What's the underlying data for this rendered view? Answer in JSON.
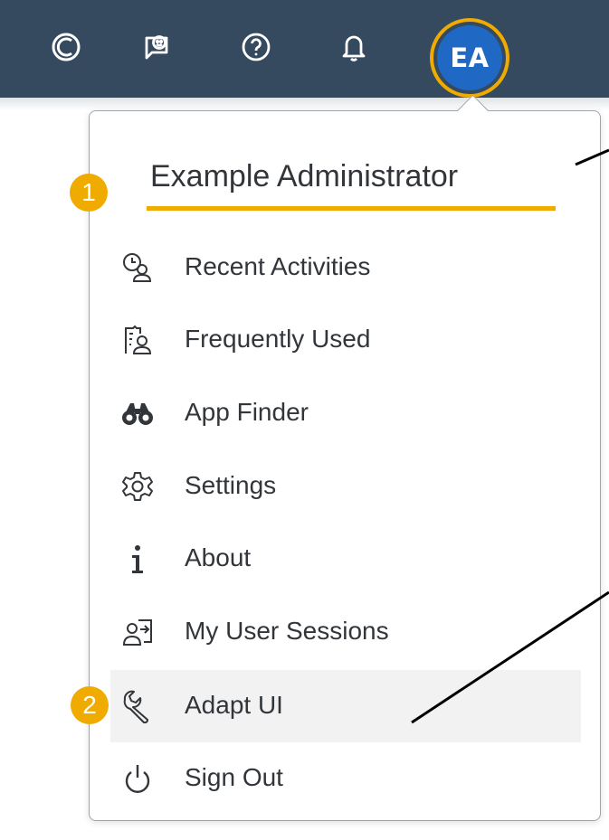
{
  "shellbar": {
    "avatar_initials": "EA",
    "icons": [
      "copilot-icon",
      "feedback-icon",
      "help-icon",
      "notification-bell-icon"
    ]
  },
  "user_menu": {
    "user_name": "Example Administrator",
    "items": [
      {
        "label": "Recent Activities",
        "icon": "recent-activities-icon"
      },
      {
        "label": "Frequently Used",
        "icon": "frequently-used-icon"
      },
      {
        "label": "App Finder",
        "icon": "binoculars-icon"
      },
      {
        "label": "Settings",
        "icon": "gear-icon"
      },
      {
        "label": "About",
        "icon": "info-icon"
      },
      {
        "label": "My User Sessions",
        "icon": "user-sessions-icon"
      },
      {
        "label": "Adapt UI",
        "icon": "wrench-icon"
      },
      {
        "label": "Sign Out",
        "icon": "power-icon"
      }
    ]
  },
  "annotations": {
    "marker_1": "1",
    "marker_2": "2"
  },
  "colors": {
    "shellbar": "#354a5f",
    "accent": "#f0ab00",
    "avatar": "#1f68c4",
    "text": "#32363a",
    "hover_row": "#f2f2f2"
  }
}
